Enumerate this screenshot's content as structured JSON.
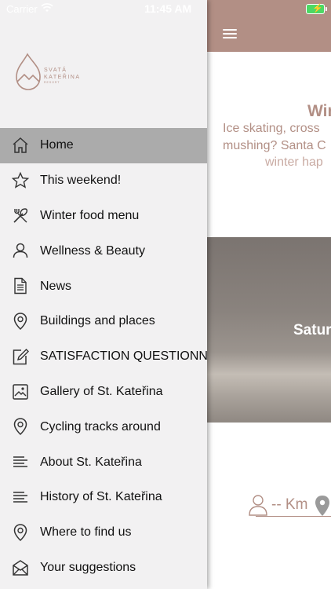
{
  "status_bar": {
    "carrier": "Carrier",
    "time": "11:45 AM"
  },
  "logo": {
    "line1": "SVATÁ",
    "line2": "KATEŘINA",
    "line3": "RESORT"
  },
  "menu": {
    "items": [
      {
        "label": "Home",
        "icon": "home-icon",
        "active": true
      },
      {
        "label": "This weekend!",
        "icon": "star-icon"
      },
      {
        "label": "Winter food menu",
        "icon": "cutlery-icon"
      },
      {
        "label": "Wellness & Beauty",
        "icon": "person-icon"
      },
      {
        "label": "News",
        "icon": "document-icon"
      },
      {
        "label": "Buildings and places",
        "icon": "location-pin-icon"
      },
      {
        "label": "SATISFACTION QUESTIONNAIRE",
        "icon": "edit-icon"
      },
      {
        "label": "Gallery of St. Kateřina",
        "icon": "image-icon"
      },
      {
        "label": "Cycling tracks around",
        "icon": "location-pin-icon"
      },
      {
        "label": "About St. Kateřina",
        "icon": "text-lines-icon"
      },
      {
        "label": "History of St. Kateřina",
        "icon": "text-lines-icon"
      },
      {
        "label": "Where to find us",
        "icon": "location-pin-icon"
      },
      {
        "label": "Your suggestions",
        "icon": "envelope-icon"
      }
    ]
  },
  "content": {
    "promo_title": "Wir",
    "promo_line1": "Ice skating, cross",
    "promo_line2": "mushing? Santa C",
    "promo_line3": "winter hap",
    "photo_caption": "Satur",
    "distance_text": "-- Km"
  },
  "colors": {
    "accent": "#b28f85",
    "drawer_bg": "#f2f1f2",
    "active_row": "#ababab"
  }
}
